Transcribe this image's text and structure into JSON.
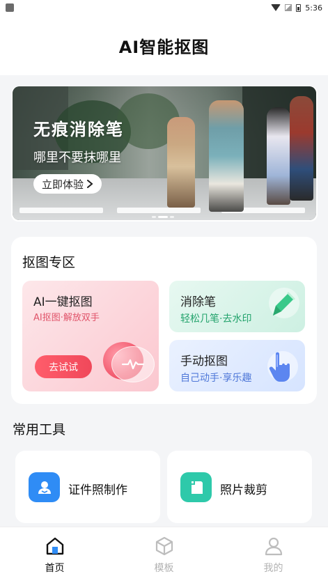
{
  "status_bar": {
    "time": "5:36"
  },
  "header": {
    "title": "AI智能抠图"
  },
  "banner": {
    "heading": "无痕消除笔",
    "subtitle": "哪里不要抹哪里",
    "cta": "立即体验"
  },
  "cutout_section": {
    "title": "抠图专区",
    "ai_tile": {
      "title": "AI一键抠图",
      "subtitle": "AI抠图·解放双手",
      "button": "去试试"
    },
    "eraser_tile": {
      "title": "消除笔",
      "subtitle": "轻松几笔·去水印"
    },
    "manual_tile": {
      "title": "手动抠图",
      "subtitle": "自己动手·享乐趣"
    }
  },
  "tools": {
    "title": "常用工具",
    "items": [
      {
        "label": "证件照制作",
        "icon": "id-photo-icon"
      },
      {
        "label": "照片裁剪",
        "icon": "crop-icon"
      }
    ]
  },
  "bottom_nav": {
    "items": [
      {
        "label": "首页",
        "icon": "home-icon",
        "active": true
      },
      {
        "label": "模板",
        "icon": "template-cube-icon",
        "active": false
      },
      {
        "label": "我的",
        "icon": "profile-icon",
        "active": false
      }
    ]
  },
  "colors": {
    "accent_red": "#f0485a",
    "accent_green": "#23a36c",
    "accent_blue": "#2f8cf5",
    "accent_teal": "#2ec9aa"
  }
}
